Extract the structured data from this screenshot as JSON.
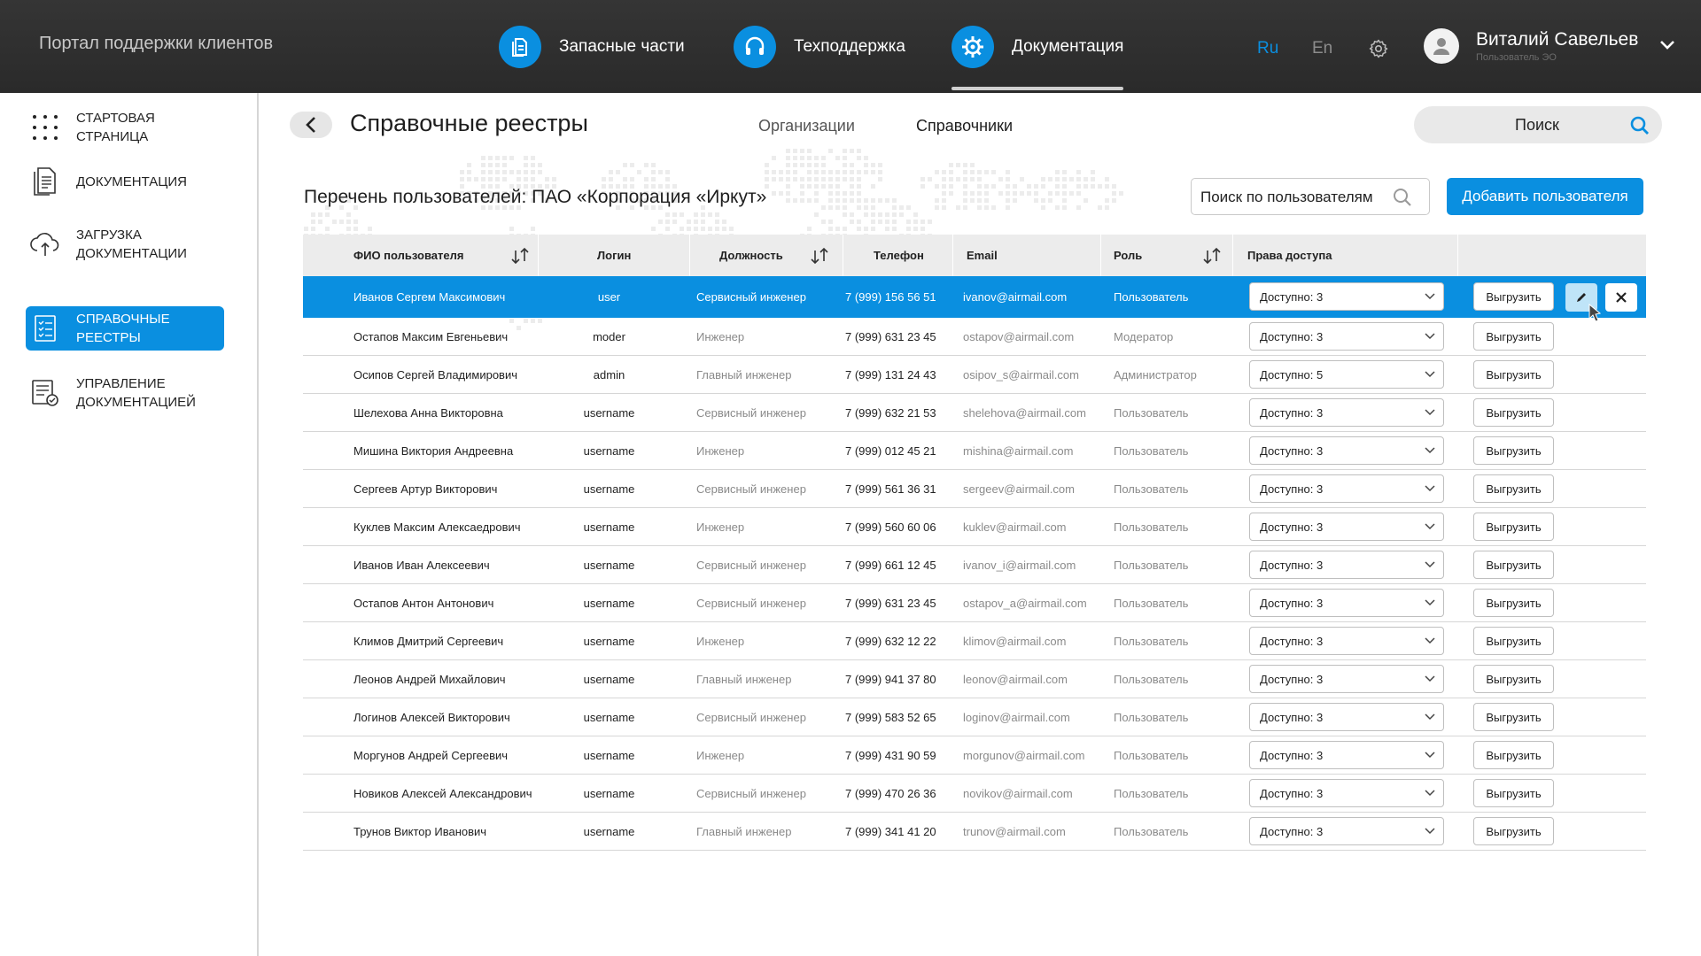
{
  "header": {
    "portal_title": "Портал поддержки клиентов",
    "nav": [
      {
        "label": "Запасные части",
        "icon": "document-icon"
      },
      {
        "label": "Техподдержка",
        "icon": "headset-icon"
      },
      {
        "label": "Документация",
        "icon": "gear-icon",
        "active": true
      }
    ],
    "lang_ru": "Ru",
    "lang_en": "En",
    "user": {
      "name": "Виталий Савельев",
      "role": "Пользователь ЭО"
    }
  },
  "sidebar": {
    "items": [
      {
        "label": "Стартовая страница",
        "icon": "dots-grid-icon"
      },
      {
        "label": "Документация",
        "icon": "document-icon"
      },
      {
        "label": "Загрузка документации",
        "icon": "cloud-upload-icon"
      },
      {
        "label": "Справочные реестры",
        "icon": "checklist-icon",
        "active": true
      },
      {
        "label": "Управление документацией",
        "icon": "document-settings-icon"
      }
    ]
  },
  "page": {
    "title": "Справочные реестры",
    "tabs": [
      "Организации",
      "Справочники"
    ],
    "search_label": "Поиск",
    "list_title": "Перечень пользователей: ПАО «Корпорация «Иркут»",
    "user_search_label": "Поиск по пользователям",
    "add_user_label": "Добавить пользователя"
  },
  "table": {
    "columns": [
      "ФИО пользователя",
      "Логин",
      "Должность",
      "Телефон",
      "Email",
      "Роль",
      "Права доступа"
    ],
    "export_label": "Выгрузить",
    "rows": [
      {
        "name": "Иванов Сергем Максимович",
        "login": "user",
        "position": "Сервисный инженер",
        "phone": "7 (999) 156 56 51",
        "email": "ivanov@airmail.com",
        "role": "Пользователь",
        "access": "Доступно: 3",
        "selected": true
      },
      {
        "name": "Остапов Максим Евгеньевич",
        "login": "moder",
        "position": "Инженер",
        "phone": "7 (999) 631 23 45",
        "email": "ostapov@airmail.com",
        "role": "Модератор",
        "access": "Доступно: 3"
      },
      {
        "name": "Осипов Сергей Владимирович",
        "login": "admin",
        "position": "Главный инженер",
        "phone": "7 (999) 131 24 43",
        "email": "osipov_s@airmail.com",
        "role": "Администратор",
        "access": "Доступно: 5"
      },
      {
        "name": "Шелехова Анна Викторовна",
        "login": "username",
        "position": "Сервисный инженер",
        "phone": "7 (999) 632 21 53",
        "email": "shelehova@airmail.com",
        "role": "Пользователь",
        "access": "Доступно: 3"
      },
      {
        "name": "Мишина Виктория Андреевна",
        "login": "username",
        "position": "Инженер",
        "phone": "7 (999) 012 45 21",
        "email": "mishina@airmail.com",
        "role": "Пользователь",
        "access": "Доступно: 3"
      },
      {
        "name": "Сергеев Артур Викторович",
        "login": "username",
        "position": "Сервисный инженер",
        "phone": "7 (999) 561 36 31",
        "email": "sergeev@airmail.com",
        "role": "Пользователь",
        "access": "Доступно: 3"
      },
      {
        "name": "Куклев Максим Алексаедрович",
        "login": "username",
        "position": "Инженер",
        "phone": "7 (999) 560 60 06",
        "email": "kuklev@airmail.com",
        "role": "Пользователь",
        "access": "Доступно: 3"
      },
      {
        "name": "Иванов Иван Алексеевич",
        "login": "username",
        "position": "Сервисный инженер",
        "phone": "7 (999) 661 12 45",
        "email": "ivanov_i@airmail.com",
        "role": "Пользователь",
        "access": "Доступно: 3"
      },
      {
        "name": "Остапов Антон Антонович",
        "login": "username",
        "position": "Сервисный инженер",
        "phone": "7 (999) 631 23 45",
        "email": "ostapov_a@airmail.com",
        "role": "Пользователь",
        "access": "Доступно: 3"
      },
      {
        "name": "Климов Дмитрий Сергеевич",
        "login": "username",
        "position": "Инженер",
        "phone": "7 (999) 632 12 22",
        "email": "klimov@airmail.com",
        "role": "Пользователь",
        "access": "Доступно: 3"
      },
      {
        "name": "Леонов Андрей Михайлович",
        "login": "username",
        "position": "Главный инженер",
        "phone": "7 (999) 941 37 80",
        "email": "leonov@airmail.com",
        "role": "Пользователь",
        "access": "Доступно: 3"
      },
      {
        "name": "Логинов Алексей Викторович",
        "login": "username",
        "position": "Сервисный инженер",
        "phone": "7 (999) 583 52 65",
        "email": "loginov@airmail.com",
        "role": "Пользователь",
        "access": "Доступно: 3"
      },
      {
        "name": "Моргунов Андрей Сергеевич",
        "login": "username",
        "position": "Инженер",
        "phone": "7 (999) 431 90 59",
        "email": "morgunov@airmail.com",
        "role": "Пользователь",
        "access": "Доступно: 3"
      },
      {
        "name": "Новиков Алексей Александрович",
        "login": "username",
        "position": "Сервисный инженер",
        "phone": "7 (999) 470 26 36",
        "email": "novikov@airmail.com",
        "role": "Пользователь",
        "access": "Доступно: 3"
      },
      {
        "name": "Трунов Виктор Иванович",
        "login": "username",
        "position": "Главный инженер",
        "phone": "7 (999) 341 41 20",
        "email": "trunov@airmail.com",
        "role": "Пользователь",
        "access": "Доступно: 3"
      }
    ]
  },
  "colors": {
    "accent": "#0a8fe0",
    "topbar": "#2f2f2f",
    "selected_row": "#0a8fe0"
  }
}
